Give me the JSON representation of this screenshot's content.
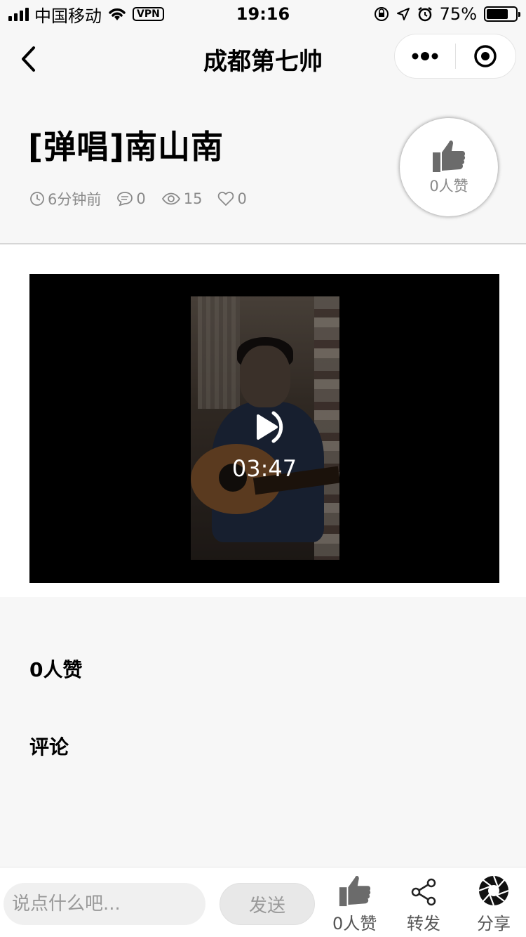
{
  "status_bar": {
    "carrier": "中国移动",
    "vpn": "VPN",
    "time": "19:16",
    "battery": "75%",
    "battery_level": 0.75
  },
  "nav": {
    "title": "成都第七帅"
  },
  "post": {
    "title": "[弹唱]南山南",
    "time_ago": "6分钟前",
    "comment_count": "0",
    "view_count": "15",
    "like_count": "0",
    "like_badge": "0人赞"
  },
  "video": {
    "duration": "03:47"
  },
  "sections": {
    "likes": "0人赞",
    "comments": "评论"
  },
  "bottom_bar": {
    "input_placeholder": "说点什么吧...",
    "send_label": "发送",
    "like_label": "0人赞",
    "forward_label": "转发",
    "share_label": "分享"
  },
  "colors": {
    "background": "#f7f7f7",
    "meta_text": "#8a8a8a",
    "icon_gray": "#6b6b6b"
  }
}
